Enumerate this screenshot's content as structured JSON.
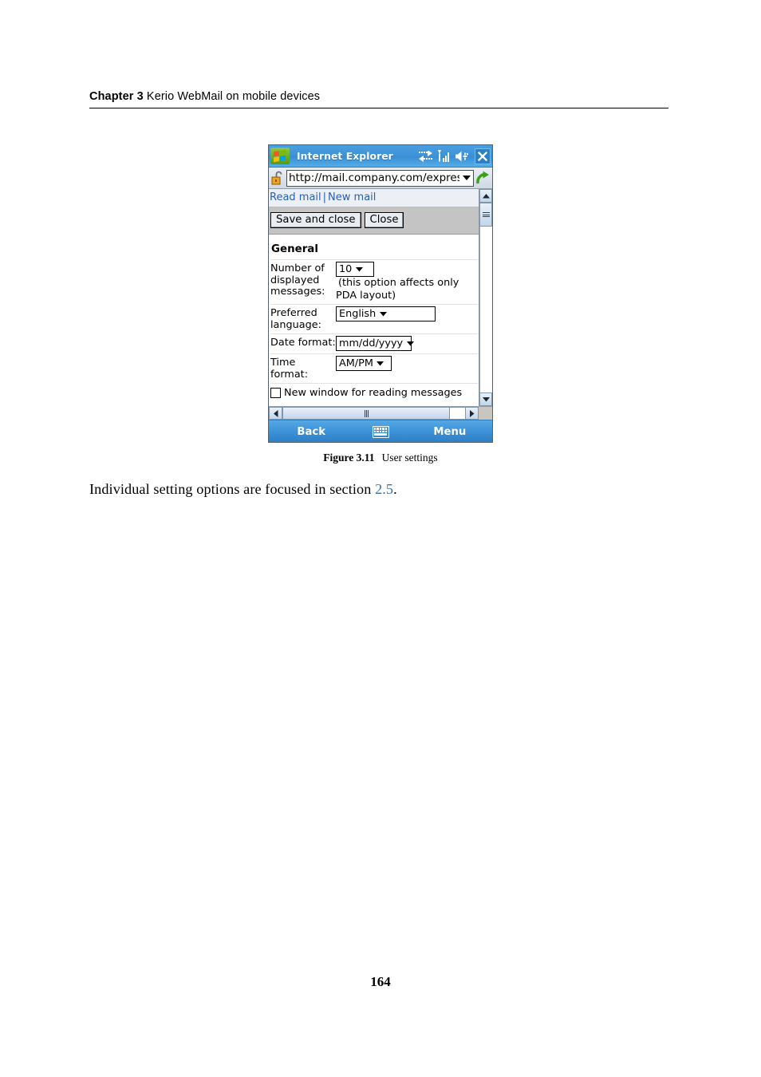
{
  "page": {
    "chapter_label": "Chapter 3",
    "chapter_title": "Kerio WebMail on mobile devices",
    "number": "164"
  },
  "figure": {
    "label": "Figure 3.11",
    "caption": "User settings"
  },
  "paragraph": {
    "before": "Individual setting options are focused in section ",
    "xref": "2.5",
    "after": "."
  },
  "pda": {
    "titlebar": {
      "app_title": "Internet Explorer",
      "logo_icon": "windows-mobile-logo-icon",
      "connectivity_icon": "connectivity-arrows-icon",
      "signal_icon": "signal-strength-icon",
      "volume_icon": "speaker-volume-icon",
      "close_icon": "close-x-icon"
    },
    "addressbar": {
      "lock_icon": "open-padlock-icon",
      "url": "http://mail.company.com/expres",
      "dropdown_icon": "chevron-down-icon",
      "go_icon": "go-refresh-arrow-icon"
    },
    "links": {
      "read_mail": "Read mail",
      "separator": "|",
      "new_mail": "New mail"
    },
    "toolbar": {
      "save_and_close": "Save and close",
      "close": "Close"
    },
    "form": {
      "section_title": "General",
      "rows": [
        {
          "label": "Number of displayed messages:",
          "control": "select",
          "value": "10",
          "hint": "(this option affects only",
          "hint2": "PDA layout)"
        },
        {
          "label": "Preferred language:",
          "control": "select",
          "value": "English"
        },
        {
          "label": "Date format:",
          "control": "select",
          "value": "mm/dd/yyyy"
        },
        {
          "label": "Time format:",
          "control": "select",
          "value": "AM/PM"
        }
      ],
      "checkbox": {
        "label": "New window for reading messages",
        "checked": false
      }
    },
    "scrollbars": {
      "vertical_up_icon": "scroll-up-arrow-icon",
      "vertical_down_icon": "scroll-down-arrow-icon",
      "horizontal_left_icon": "scroll-left-arrow-icon",
      "horizontal_right_icon": "scroll-right-arrow-icon"
    },
    "taskbar": {
      "back": "Back",
      "keyboard_icon": "soft-keyboard-icon",
      "menu": "Menu"
    },
    "colors": {
      "titlebar_blue": "#3f93d8",
      "link_blue": "#2b5fb0",
      "toolbar_gray": "#c4c4c4",
      "xref_blue": "#3a6fa8"
    }
  }
}
